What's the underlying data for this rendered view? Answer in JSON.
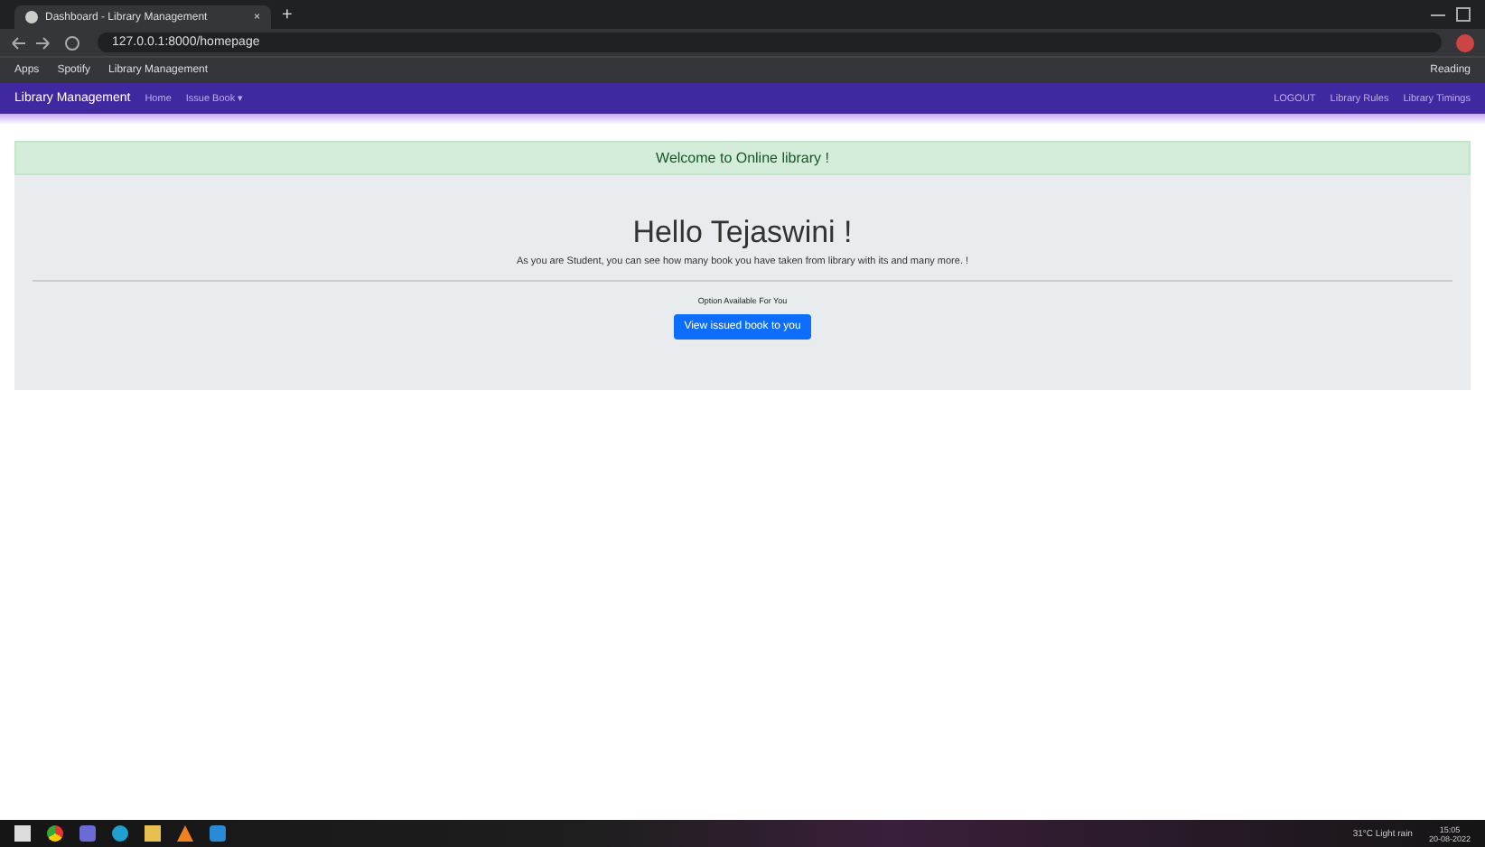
{
  "browser": {
    "tab_title": "Dashboard - Library Management",
    "tab_close": "×",
    "new_tab": "+",
    "address": "127.0.0.1:8000/homepage",
    "bookmarks": [
      "Apps",
      "Spotify",
      "Library Management"
    ],
    "reading_list": "Reading"
  },
  "navbar": {
    "brand": "Library Management",
    "links": [
      {
        "label": "Home",
        "selected": false
      },
      {
        "label": "Issue Book ▾",
        "selected": false
      }
    ],
    "right_links": [
      "LOGOUT",
      "Library Rules",
      "Library Timings"
    ]
  },
  "alert": "Welcome to Online library !",
  "hero": {
    "heading": "Hello Tejaswini !",
    "text": "As you are Student, you can see how many book you have taken from library with its and many more. !",
    "note": "Option Available For You",
    "button": "View issued book to you"
  },
  "taskbar": {
    "weather": "31°C Light rain",
    "time": "15:05",
    "date": "20-08-2022"
  }
}
